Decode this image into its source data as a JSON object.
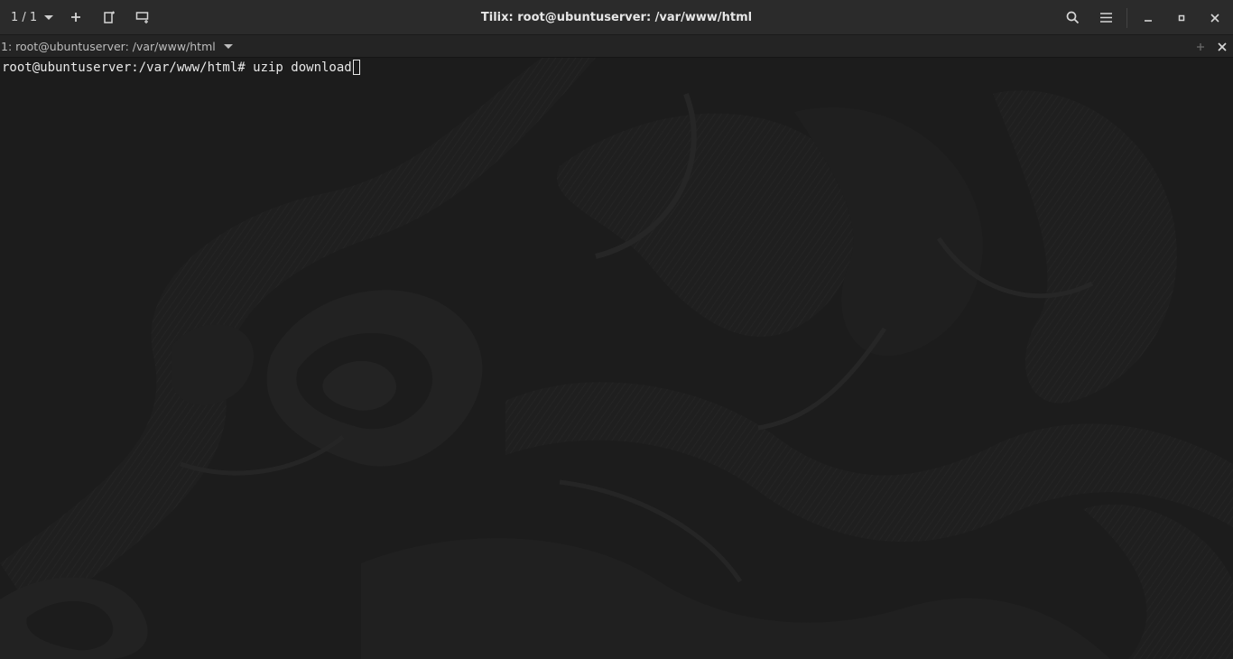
{
  "header": {
    "session_indicator": "1 / 1",
    "title": "Tilix: root@ubuntuserver: /var/www/html",
    "icons": {
      "session_menu": "chevron-down-icon",
      "add_terminal": "plus-icon",
      "add_right": "split-right-icon",
      "add_down": "split-down-icon",
      "search": "search-icon",
      "menu": "hamburger-menu-icon",
      "minimize": "minimize-icon",
      "maximize": "maximize-icon",
      "close": "close-icon"
    }
  },
  "terminal_bar": {
    "title": "1: root@ubuntuserver: /var/www/html",
    "icons": {
      "title_menu": "chevron-down-icon",
      "maximize_terminal": "plus-icon",
      "close_terminal": "close-icon"
    }
  },
  "terminal": {
    "prompt": "root@ubuntuserver:/var/www/html#",
    "command": " uzip download"
  },
  "colors": {
    "headerbar": "#2b2b2b",
    "terminal_bar": "#242424",
    "terminal_background": "#1c1c1c",
    "foreground": "#e8e8e8"
  }
}
